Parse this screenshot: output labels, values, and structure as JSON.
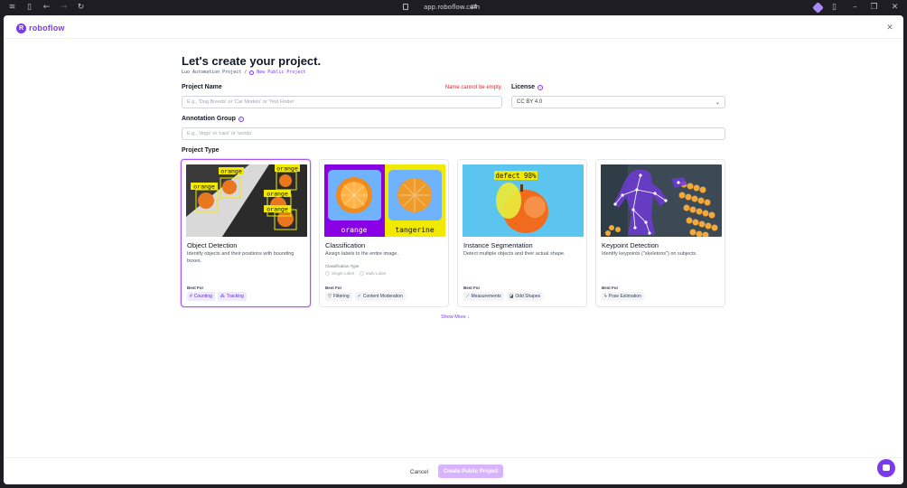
{
  "browser": {
    "url": "app.roboflow.com"
  },
  "brand": {
    "name": "roboflow"
  },
  "page": {
    "title": "Let's create your project.",
    "breadcrumb": {
      "workspace": "Luo Automation Project",
      "separator": "/",
      "current": "New Public Project"
    }
  },
  "form": {
    "project_name": {
      "label": "Project Name",
      "placeholder": "E.g., 'Dog Breeds' or 'Car Models' or 'Text Finder'",
      "error": "Name cannot be empty."
    },
    "license": {
      "label": "License",
      "value": "CC BY 4.0"
    },
    "annotation_group": {
      "label": "Annotation Group",
      "placeholder": "E.g., 'dogs' or 'cars' or 'words'"
    },
    "project_type_label": "Project Type"
  },
  "cards": [
    {
      "title": "Object Detection",
      "desc": "Identify objects and their positions with bounding boxes.",
      "best_for": "Best For",
      "tags": [
        "Counting",
        "Tracking"
      ],
      "image_labels": [
        "orange",
        "orange",
        "orange",
        "orange",
        "orange"
      ]
    },
    {
      "title": "Classification",
      "desc": "Assign labels to the entire image.",
      "classification_type": "Classification Type",
      "options": [
        "Single-Label",
        "Multi-Label"
      ],
      "best_for": "Best For",
      "tags": [
        "Filtering",
        "Content Moderation"
      ],
      "image_labels": [
        "orange",
        "tangerine"
      ]
    },
    {
      "title": "Instance Segmentation",
      "desc": "Detect multiple objects and their actual shape.",
      "best_for": "Best For",
      "tags": [
        "Measurements",
        "Odd Shapes"
      ],
      "image_labels": [
        "defect 98%"
      ]
    },
    {
      "title": "Keypoint Detection",
      "desc": "Identify keypoints (\"skeletons\") on subjects.",
      "best_for": "Best For",
      "tags": [
        "Pose Estimation"
      ]
    }
  ],
  "show_more": "Show More",
  "footer": {
    "cancel": "Cancel",
    "create": "Create Public Project"
  },
  "colors": {
    "accent": "#7c3aed",
    "error": "#dc2626",
    "create_disabled": "#d8b4fe"
  }
}
